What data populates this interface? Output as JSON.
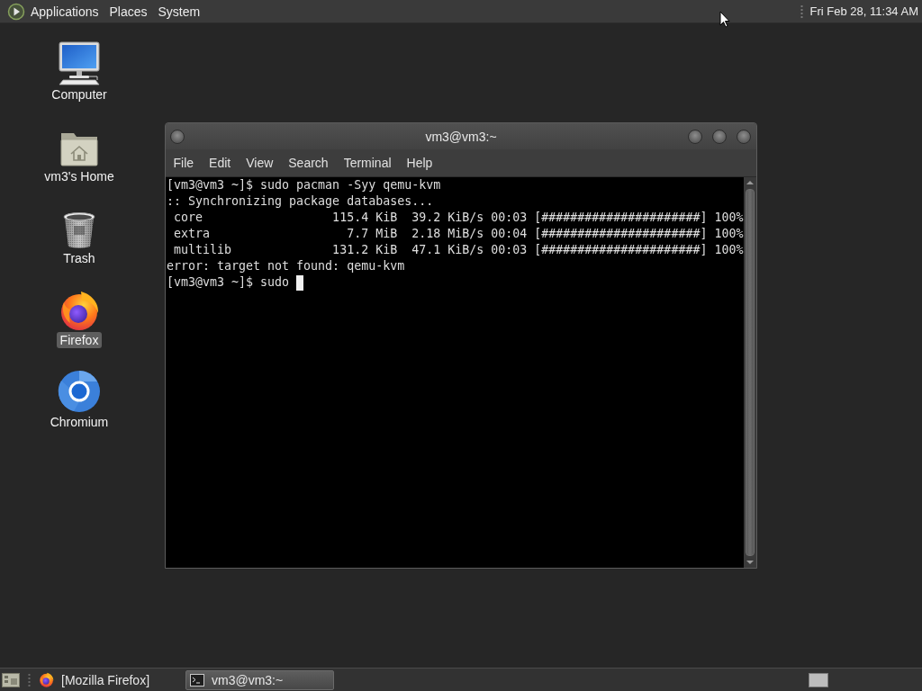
{
  "top_panel": {
    "menus": [
      "Applications",
      "Places",
      "System"
    ],
    "clock": "Fri Feb 28, 11:34 AM"
  },
  "desktop_icons": [
    {
      "label": "Computer",
      "kind": "computer",
      "selected": false
    },
    {
      "label": "vm3's Home",
      "kind": "home",
      "selected": false
    },
    {
      "label": "Trash",
      "kind": "trash",
      "selected": false
    },
    {
      "label": "Firefox",
      "kind": "firefox",
      "selected": true
    },
    {
      "label": "Chromium",
      "kind": "chromium",
      "selected": false
    }
  ],
  "terminal_window": {
    "title": "vm3@vm3:~",
    "menu": [
      "File",
      "Edit",
      "View",
      "Search",
      "Terminal",
      "Help"
    ],
    "lines": [
      "[vm3@vm3 ~]$ sudo pacman -Syy qemu-kvm",
      ":: Synchronizing package databases...",
      " core                  115.4 KiB  39.2 KiB/s 00:03 [######################] 100%",
      " extra                   7.7 MiB  2.18 MiB/s 00:04 [######################] 100%",
      " multilib              131.2 KiB  47.1 KiB/s 00:03 [######################] 100%",
      "error: target not found: qemu-kvm",
      "[vm3@vm3 ~]$ sudo"
    ],
    "cursor": true
  },
  "bottom_panel": {
    "tasks": [
      {
        "label": "[Mozilla Firefox]",
        "kind": "firefox",
        "selected": false
      },
      {
        "label": "vm3@vm3:~",
        "kind": "terminal",
        "selected": true
      }
    ]
  }
}
